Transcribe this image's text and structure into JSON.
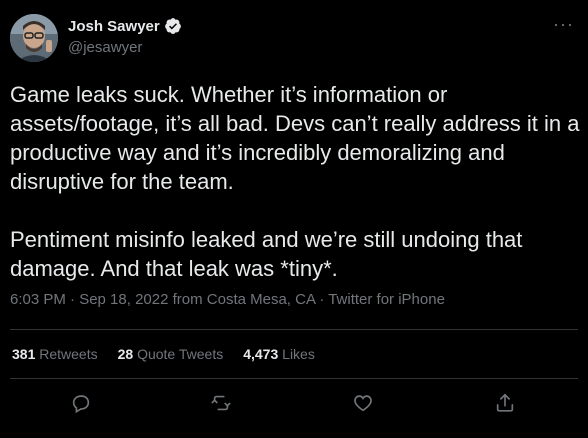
{
  "author": {
    "display_name": "Josh Sawyer",
    "handle": "@jesawyer",
    "verified": true
  },
  "tweet": {
    "paragraphs": [
      "Game leaks suck. Whether it’s information or assets/footage, it’s all bad. Devs can’t really address it in a productive way and it’s incredibly demoralizing and disruptive for the team.",
      "Pentiment misinfo leaked and we’re still undoing that damage. And that leak was *tiny*."
    ],
    "meta": "6:03 PM · Sep 18, 2022 from Costa Mesa, CA · Twitter for iPhone"
  },
  "stats": {
    "retweets_count": "381",
    "retweets_label": "Retweets",
    "quotes_count": "28",
    "quotes_label": "Quote Tweets",
    "likes_count": "4,473",
    "likes_label": "Likes"
  },
  "icons": {
    "reply": "reply-icon",
    "retweet": "retweet-icon",
    "like": "like-icon",
    "share": "share-icon",
    "more": "more-icon",
    "verified": "verified-badge-icon"
  },
  "colors": {
    "background": "#000000",
    "text": "#e7e9ea",
    "secondary": "#71767b",
    "divider": "#2f3336"
  }
}
